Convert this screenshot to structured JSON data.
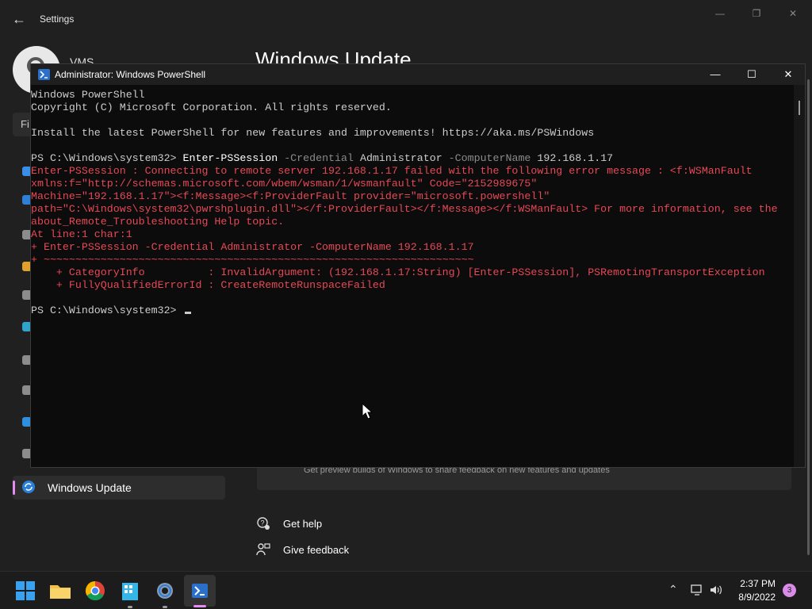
{
  "settings": {
    "title": "Settings",
    "heading": "Windows Update",
    "user_fragment": "VMS",
    "find_fragment": "Fi",
    "nav_active_label": "Windows Update",
    "insider_text": "Get preview builds of Windows to share feedback on new features and updates",
    "help_label": "Get help",
    "feedback_label": "Give feedback"
  },
  "powershell": {
    "title": "Administrator: Windows PowerShell",
    "lines": {
      "l1": "Windows PowerShell",
      "l2": "Copyright (C) Microsoft Corporation. All rights reserved.",
      "l4": "Install the latest PowerShell for new features and improvements! https://aka.ms/PSWindows",
      "p1_prompt": "PS C:\\Windows\\system32> ",
      "p1_cmd": "Enter-PSSession",
      "p1_param1": " -Credential",
      "p1_arg1": " Administrator",
      "p1_param2": " -ComputerName",
      "p1_arg2": " 192.168.1.17",
      "e1": "Enter-PSSession : Connecting to remote server 192.168.1.17 failed with the following error message : <f:WSManFault",
      "e2": "xmlns:f=\"http://schemas.microsoft.com/wbem/wsman/1/wsmanfault\" Code=\"2152989675\"",
      "e3": "Machine=\"192.168.1.17\"><f:Message><f:ProviderFault provider=\"microsoft.powershell\"",
      "e4": "path=\"C:\\Windows\\system32\\pwrshplugin.dll\"></f:ProviderFault></f:Message></f:WSManFault> For more information, see the",
      "e5": "about_Remote_Troubleshooting Help topic.",
      "e6": "At line:1 char:1",
      "e7": "+ Enter-PSSession -Credential Administrator -ComputerName 192.168.1.17",
      "e8": "+ ~~~~~~~~~~~~~~~~~~~~~~~~~~~~~~~~~~~~~~~~~~~~~~~~~~~~~~~~~~~~~~~~~~~~",
      "e9": "    + CategoryInfo          : InvalidArgument: (192.168.1.17:String) [Enter-PSSession], PSRemotingTransportException",
      "e10": "    + FullyQualifiedErrorId : CreateRemoteRunspaceFailed",
      "p2_prompt": "PS C:\\Windows\\system32> "
    }
  },
  "taskbar": {
    "time": "2:37 PM",
    "date": "8/9/2022",
    "notification_count": "3"
  },
  "colors": {
    "error": "#e74856",
    "accent": "#e48cf0",
    "console_bg": "#0c0c0c"
  }
}
